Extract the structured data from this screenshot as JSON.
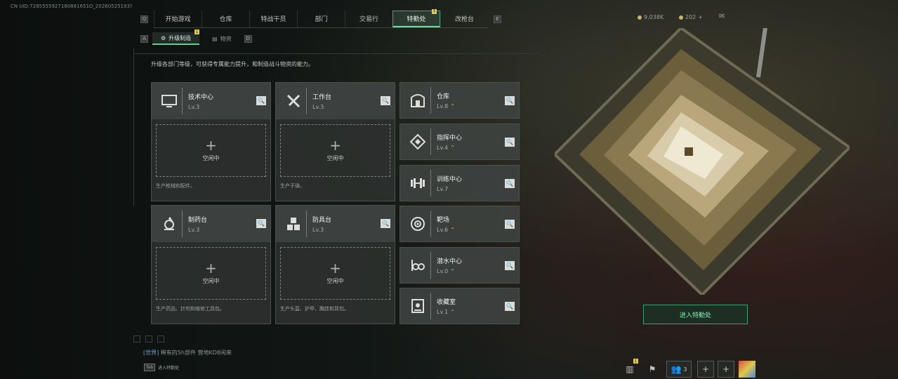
{
  "uid": "CN UID:7285555927180881651O_20260525193?",
  "nav": {
    "tabs": [
      "开始游戏",
      "仓库",
      "特战干员",
      "部门",
      "交易行",
      "特勤处",
      "改枪台"
    ],
    "active": 5,
    "key_left": "Q",
    "key_right": "E",
    "badge": "1"
  },
  "subnav": {
    "tabs": [
      "升级制造",
      "物资"
    ],
    "key_left": "A",
    "key_right": "D",
    "badge": "1"
  },
  "description": "升级各部门等级，可获得专属能力提升，和制造战斗物资的能力。",
  "currency": {
    "a": "9,038K",
    "b": "202"
  },
  "facilities": {
    "tech": {
      "name": "技术中心",
      "lv": "Lv.3",
      "idle": "空闲中",
      "produce": "生产枪械和配件。"
    },
    "workbench": {
      "name": "工作台",
      "lv": "Lv.3",
      "idle": "空闲中",
      "produce": "生产子弹。"
    },
    "pharma": {
      "name": "制药台",
      "lv": "Lv.3",
      "idle": "空闲中",
      "produce": "生产药品、针剂和维修工具包。"
    },
    "armor": {
      "name": "防具台",
      "lv": "Lv.3",
      "idle": "空闲中",
      "produce": "生产头盔、护甲、胸挂和背包。"
    },
    "storage": {
      "name": "仓库",
      "lv": "Lv.8"
    },
    "command": {
      "name": "指挥中心",
      "lv": "Lv.4"
    },
    "training": {
      "name": "训练中心",
      "lv": "Lv.7"
    },
    "range": {
      "name": "靶场",
      "lv": "Lv.6"
    },
    "dive": {
      "name": "潜水中心",
      "lv": "Lv.0"
    },
    "collection": {
      "name": "收藏室",
      "lv": "Lv.1"
    }
  },
  "enter_button": "进入特勤处",
  "chat": {
    "channel": "[世界]",
    "text": "稀有的5h部件  营地KD8闲来"
  },
  "tab_hint": {
    "key": "Tab",
    "label": "进入特勤处"
  },
  "bottom_badge": "1",
  "friends_count": "3",
  "colors": {
    "accent": "#6fe0a6",
    "upgrade": "#e0b84c"
  }
}
